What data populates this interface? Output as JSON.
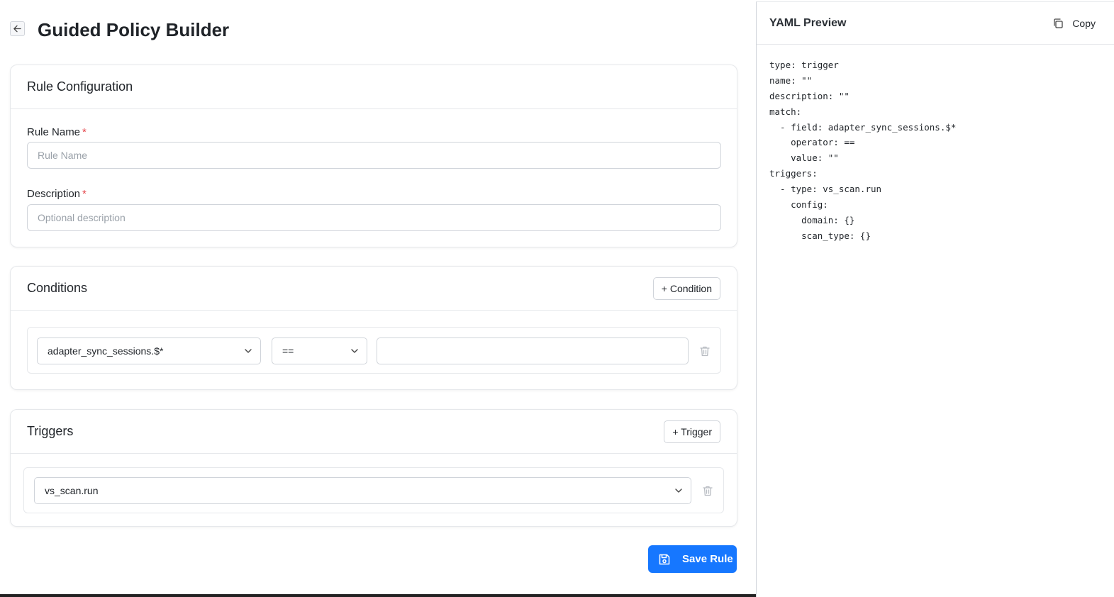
{
  "page": {
    "title": "Guided Policy Builder"
  },
  "rule_config": {
    "title": "Rule Configuration",
    "name_label": "Rule Name",
    "name_placeholder": "Rule Name",
    "name_value": "",
    "desc_label": "Description",
    "desc_placeholder": "Optional description",
    "desc_value": "",
    "required_mark": "*"
  },
  "conditions": {
    "title": "Conditions",
    "add_label": "+ Condition",
    "rows": [
      {
        "field": "adapter_sync_sessions.$*",
        "operator": "==",
        "value": ""
      }
    ]
  },
  "triggers": {
    "title": "Triggers",
    "add_label": "+ Trigger",
    "rows": [
      {
        "type": "vs_scan.run"
      }
    ]
  },
  "actions": {
    "save_label": "Save Rule"
  },
  "preview": {
    "title": "YAML Preview",
    "copy_label": "Copy",
    "lines": [
      "type: trigger",
      "name: \"\"",
      "description: \"\"",
      "match:",
      "  - field: adapter_sync_sessions.$*",
      "    operator: ==",
      "    value: \"\"",
      "triggers:",
      "  - type: vs_scan.run",
      "    config:",
      "      domain: {}",
      "      scan_type: {}"
    ]
  },
  "colors": {
    "accent": "#1677ff",
    "required": "#e5484d",
    "border": "#d0d4da"
  },
  "icons": {
    "back": "arrow-left-icon",
    "delete": "trash-icon",
    "copy": "copy-icon",
    "save": "floppy-disk-icon",
    "dropdown": "chevron-down-icon"
  }
}
